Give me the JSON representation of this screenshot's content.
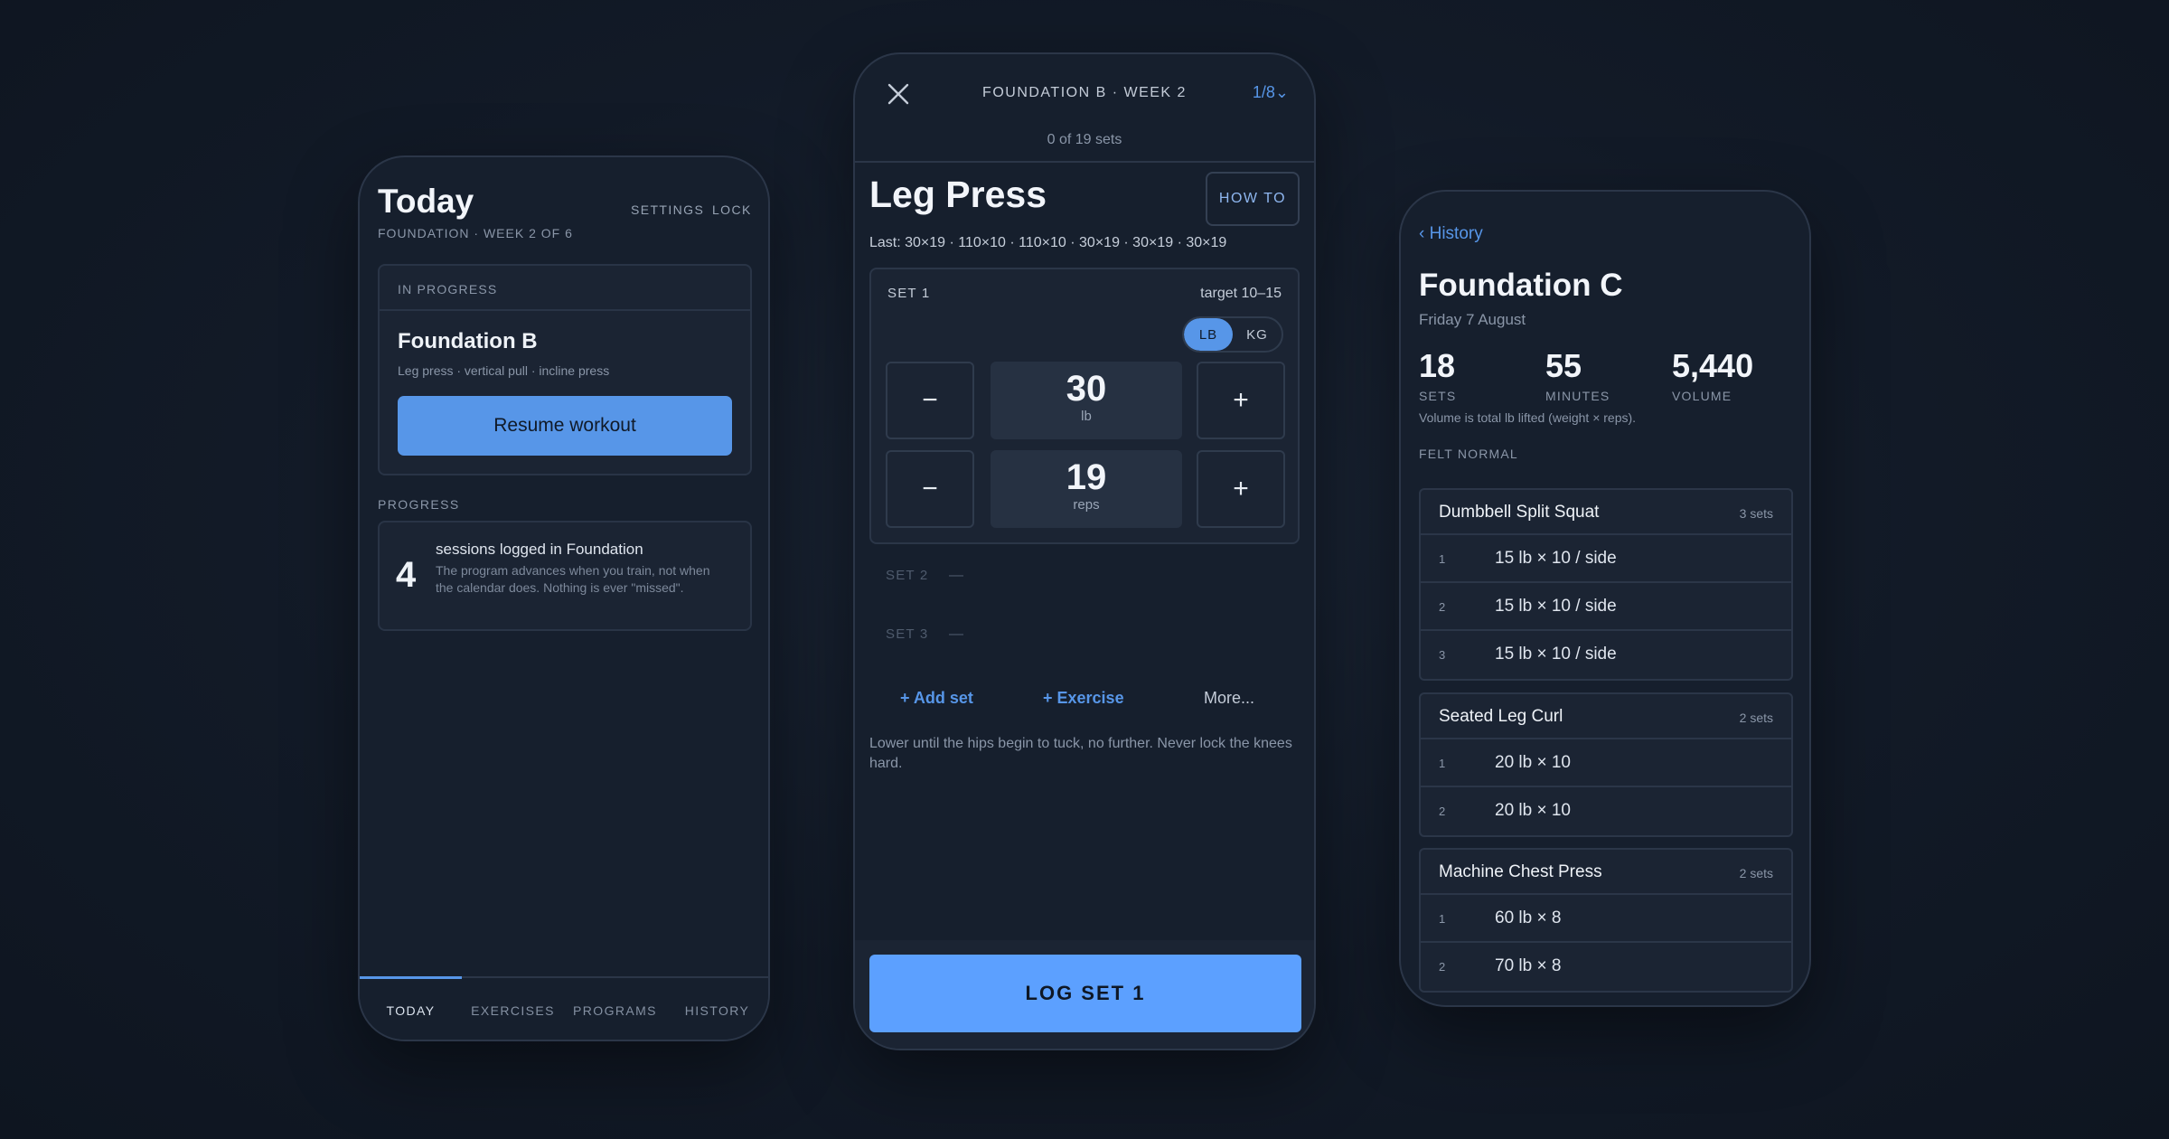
{
  "today": {
    "title": "Today",
    "subtitle": "FOUNDATION · WEEK 2 OF 6",
    "settings_label": "SETTINGS",
    "lock_label": "LOCK",
    "in_progress_label": "IN PROGRESS",
    "workout_name": "Foundation B",
    "workout_exercises": "Leg press · vertical pull · incline press",
    "resume_label": "Resume workout",
    "progress_label": "PROGRESS",
    "sessions_count": "4",
    "sessions_text": "sessions logged in Foundation",
    "sessions_note": "The program advances when you train, not when the calendar does. Nothing is ever \"missed\".",
    "tabs": [
      {
        "label": "TODAY",
        "active": true
      },
      {
        "label": "EXERCISES",
        "active": false
      },
      {
        "label": "PROGRAMS",
        "active": false
      },
      {
        "label": "HISTORY",
        "active": false
      }
    ]
  },
  "log": {
    "header_title": "FOUNDATION B · WEEK 2",
    "counter": "1/8⌄",
    "sets_progress": "0 of 19 sets",
    "exercise": "Leg Press",
    "how_to_label": "HOW TO",
    "last": "Last: 30×19 · 110×10 · 110×10 · 30×19 · 30×19 · 30×19",
    "current_set": {
      "label": "SET 1",
      "target": "target 10–15",
      "units": [
        "LB",
        "KG"
      ],
      "selected_unit": "LB",
      "weight": "30",
      "weight_unit": "lb",
      "reps": "19",
      "reps_unit": "reps",
      "minus": "−",
      "plus": "+"
    },
    "pending_sets": [
      {
        "label": "SET 2",
        "value": "—"
      },
      {
        "label": "SET 3",
        "value": "—"
      }
    ],
    "add_set_label": "+ Add set",
    "add_exercise_label": "+ Exercise",
    "more_label": "More...",
    "note": "Lower until the hips begin to tuck, no further. Never lock the knees hard.",
    "log_button": "LOG SET 1"
  },
  "history": {
    "back_label": "‹ History",
    "title": "Foundation C",
    "date": "Friday 7 August",
    "stats": [
      {
        "value": "18",
        "label": "SETS"
      },
      {
        "value": "55",
        "label": "MINUTES"
      },
      {
        "value": "5,440",
        "label": "VOLUME"
      }
    ],
    "volume_note": "Volume is total lb lifted (weight × reps).",
    "felt": "FELT NORMAL",
    "exercises": [
      {
        "name": "Dumbbell Split Squat",
        "count": "3 sets",
        "rows": [
          {
            "index": "1",
            "value": "15 lb × 10 / side"
          },
          {
            "index": "2",
            "value": "15 lb × 10 / side"
          },
          {
            "index": "3",
            "value": "15 lb × 10 / side"
          }
        ]
      },
      {
        "name": "Seated Leg Curl",
        "count": "2 sets",
        "rows": [
          {
            "index": "1",
            "value": "20 lb × 10"
          },
          {
            "index": "2",
            "value": "20 lb × 10"
          }
        ]
      },
      {
        "name": "Machine Chest Press",
        "count": "2 sets",
        "rows": [
          {
            "index": "1",
            "value": "60 lb × 8"
          },
          {
            "index": "2",
            "value": "70 lb × 8"
          }
        ]
      }
    ]
  },
  "colors": {
    "accent": "#5796e8",
    "background": "#121a27",
    "surface": "#1b2433"
  }
}
